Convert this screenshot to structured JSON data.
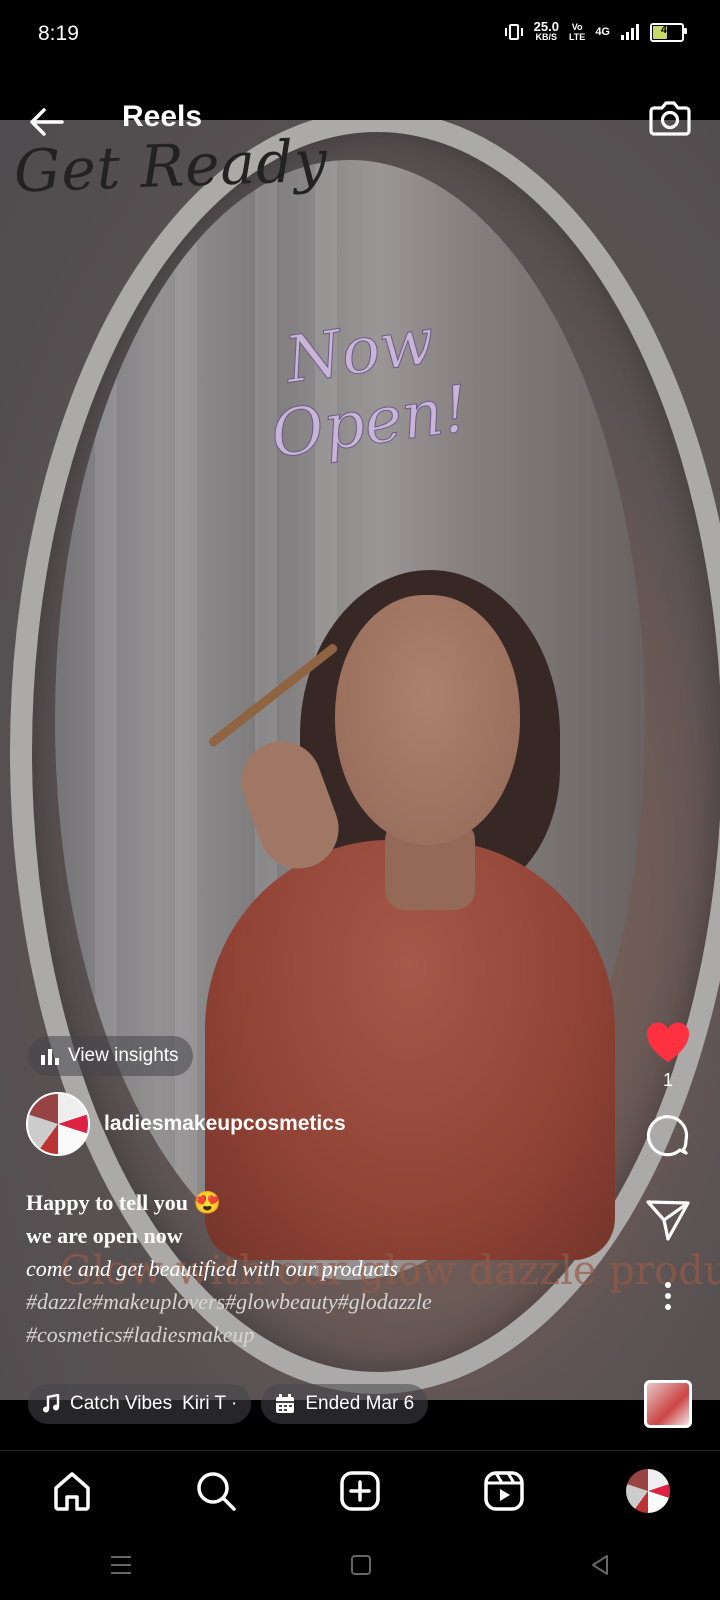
{
  "status_bar": {
    "time": "8:19",
    "speed_value": "25.0",
    "speed_unit": "KB/S",
    "volte_top": "Vo",
    "volte_bottom": "LTE",
    "network": "4G",
    "battery": "48"
  },
  "header": {
    "title": "Reels",
    "back_icon": "back-arrow-icon",
    "camera_icon": "camera-icon"
  },
  "media_overlay": {
    "top_title": "Get Ready",
    "center_line1": "Now",
    "center_line2": "Open!",
    "bottom_text": "Glow with our glow dazzle products"
  },
  "insights": {
    "label": "View insights"
  },
  "profile": {
    "username": "ladiesmakeupcosmetics"
  },
  "caption": {
    "line1": "Happy to tell you 😍",
    "line2": "we are open now",
    "line3": "come and get beautified with our products",
    "tags1": "#dazzle#makeuplovers#glowbeauty#glodazzle",
    "tags2": "#cosmetics#ladiesmakeup"
  },
  "audio": {
    "track": "Catch Vibes",
    "artist": "Kiri T ·"
  },
  "event": {
    "label": "Ended Mar 6"
  },
  "actions": {
    "like_count": "1"
  },
  "colors": {
    "like": "#ff3040",
    "background": "#000000"
  }
}
